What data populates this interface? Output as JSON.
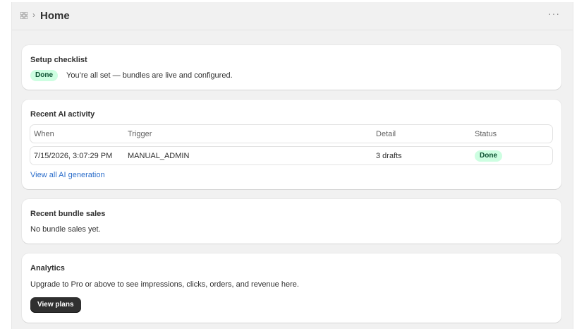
{
  "header": {
    "title": "Home",
    "separator": "›",
    "more_label": "···"
  },
  "setup": {
    "title": "Setup checklist",
    "badge": "Done",
    "message": "You’re all set — bundles are live and configured."
  },
  "ai_activity": {
    "title": "Recent AI activity",
    "columns": [
      "When",
      "Trigger",
      "Detail",
      "Status"
    ],
    "rows": [
      {
        "when": "7/15/2026, 3:07:29 PM",
        "trigger": "MANUAL_ADMIN",
        "detail": "3 drafts",
        "status": "Done"
      }
    ],
    "link": "View all AI generation"
  },
  "bundle_sales": {
    "title": "Recent bundle sales",
    "empty": "No bundle sales yet."
  },
  "analytics": {
    "title": "Analytics",
    "message": "Upgrade to Pro or above to see impressions, clicks, orders, and revenue here.",
    "button": "View plans"
  },
  "colors": {
    "badge_bg": "#cdfee1",
    "badge_text": "#0c5132",
    "link": "#2c6ecb",
    "button": "#303030"
  },
  "icons": {
    "app": "apps-icon",
    "more": "more-horizontal-icon"
  }
}
